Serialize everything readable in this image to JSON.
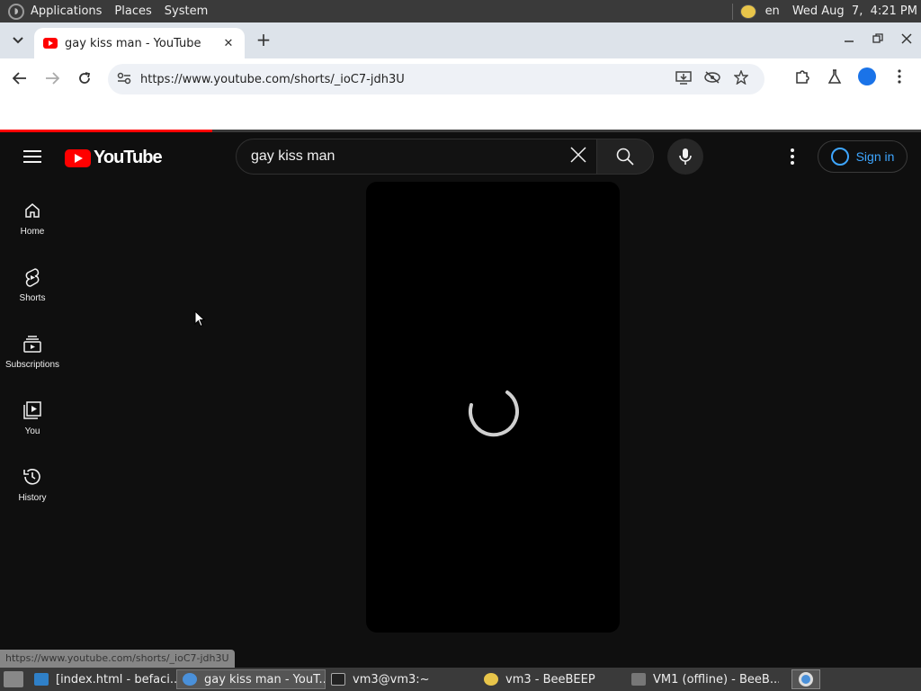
{
  "os_panel": {
    "menus": [
      "Applications",
      "Places",
      "System"
    ],
    "language": "en",
    "clock": "Wed Aug  7,  4:21 PM"
  },
  "browser": {
    "tab": {
      "title": "gay kiss man - YouTube",
      "close_glyph": "✕"
    },
    "new_tab_glyph": "+",
    "url": "https://www.youtube.com/shorts/_ioC7-jdh3U",
    "status_url": "https://www.youtube.com/shorts/_ioC7-jdh3U",
    "load_progress": 0.23
  },
  "youtube": {
    "logo_text": "YouTube",
    "search_query": "gay kiss man",
    "sign_in_label": "Sign in",
    "sidebar": [
      {
        "label": "Home",
        "icon": "home-icon"
      },
      {
        "label": "Shorts",
        "icon": "shorts-icon"
      },
      {
        "label": "Subscriptions",
        "icon": "subscriptions-icon"
      },
      {
        "label": "You",
        "icon": "you-icon"
      },
      {
        "label": "History",
        "icon": "history-icon"
      }
    ],
    "player_state": "loading"
  },
  "taskbar": {
    "tasks": [
      {
        "label": "[index.html - befaci...",
        "icon": "vscode-icon",
        "active": false
      },
      {
        "label": "gay kiss man - YouT...",
        "icon": "chrome-icon",
        "active": true
      },
      {
        "label": "vm3@vm3:~",
        "icon": "terminal-icon",
        "active": false
      },
      {
        "label": "vm3 - BeeBEEP",
        "icon": "beebeep-icon",
        "active": false
      },
      {
        "label": "VM1 (offline) - BeeB...",
        "icon": "vm-icon",
        "active": false
      }
    ]
  },
  "colors": {
    "youtube_red": "#ff0000",
    "youtube_bg": "#0f0f0f",
    "link_blue": "#3ea6ff",
    "chrome_tabstrip": "#dde3ea"
  }
}
